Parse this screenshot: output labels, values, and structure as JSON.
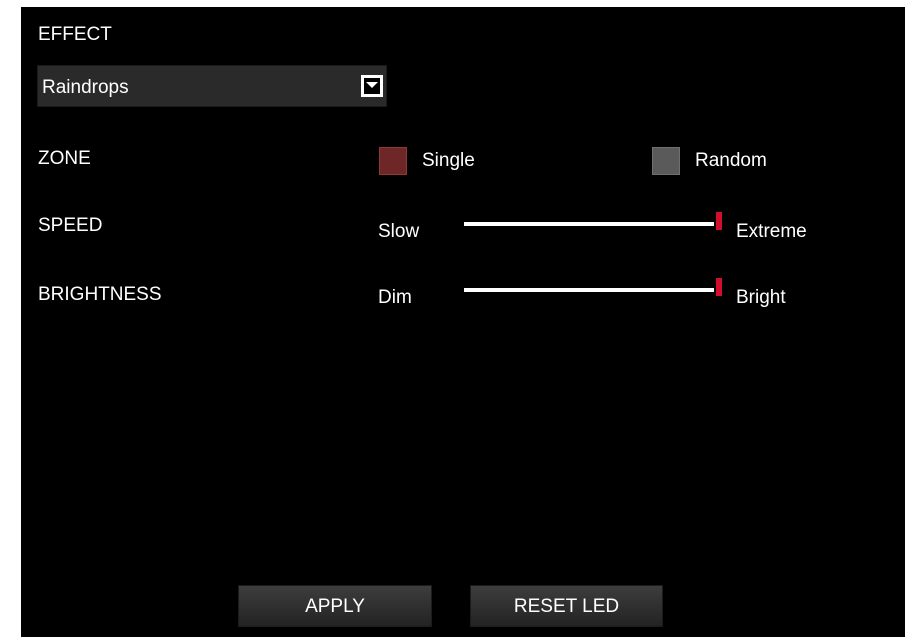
{
  "effect": {
    "label": "EFFECT",
    "selected": "Raindrops"
  },
  "zone": {
    "label": "ZONE",
    "options": [
      {
        "label": "Single",
        "selected": true,
        "color": "#6e2626"
      },
      {
        "label": "Random",
        "selected": false,
        "color": "#5a5a5a"
      }
    ]
  },
  "speed": {
    "label": "SPEED",
    "min_label": "Slow",
    "max_label": "Extreme",
    "value_fraction": 1.0
  },
  "brightness": {
    "label": "BRIGHTNESS",
    "min_label": "Dim",
    "max_label": "Bright",
    "value_fraction": 1.0
  },
  "buttons": {
    "apply": "APPLY",
    "reset": "RESET LED"
  },
  "colors": {
    "background": "#000000",
    "accent_red": "#d0102a",
    "selected_zone": "#6e2626",
    "unselected_zone": "#5a5a5a"
  }
}
